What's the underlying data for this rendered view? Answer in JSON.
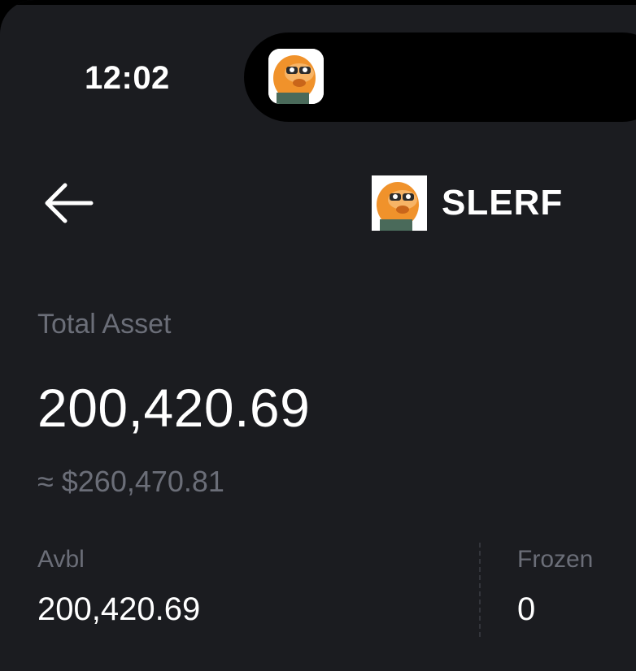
{
  "status_bar": {
    "time": "12:02"
  },
  "header": {
    "back_icon": "arrow-left-icon",
    "token_logo": "slerf-logo",
    "token_name": "SLERF"
  },
  "asset": {
    "total_label": "Total Asset",
    "total_value": "200,420.69",
    "usd_value": "≈ $260,470.81"
  },
  "breakdown": {
    "avbl_label": "Avbl",
    "avbl_value": "200,420.69",
    "frozen_label": "Frozen",
    "frozen_value": "0"
  },
  "colors": {
    "background": "#1b1c20",
    "muted_text": "#6b6e78",
    "primary_text": "#ffffff",
    "logo_orange": "#f0922b"
  }
}
